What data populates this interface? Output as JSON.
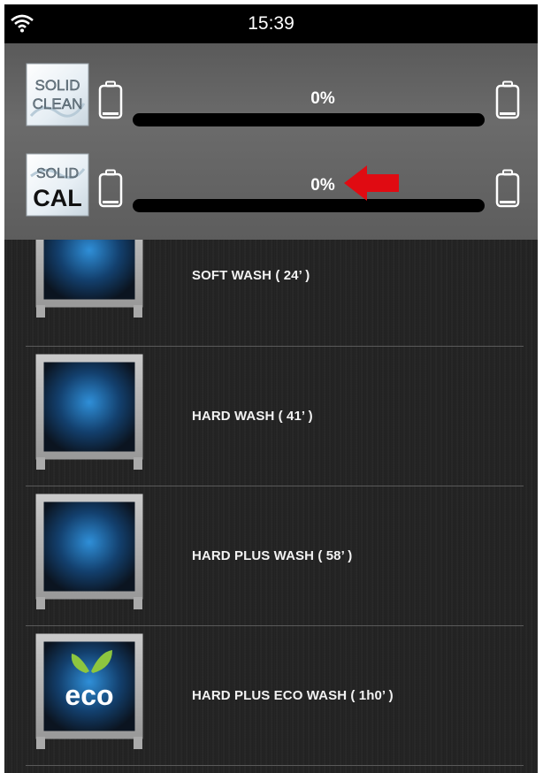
{
  "status_bar": {
    "time": "15:39",
    "wifi_icon": "wifi-icon"
  },
  "products": [
    {
      "logo_text": [
        "SOLID",
        "CLEAN"
      ],
      "left_icon": "battery-empty-icon",
      "right_icon": "battery-empty-icon",
      "level_text": "0%",
      "level_fraction": 0
    },
    {
      "logo_text": [
        "SOLID",
        "CAL"
      ],
      "left_icon": "battery-empty-icon",
      "right_icon": "battery-empty-icon",
      "level_text": "0%",
      "level_fraction": 0
    }
  ],
  "indicator_arrow": {
    "icon": "arrow-left-icon",
    "color": "#e00b12"
  },
  "wash_programs": [
    {
      "label": "SOFT WASH ( 24’ )",
      "icon": "dishwasher-icon"
    },
    {
      "label": "HARD WASH ( 41’ )",
      "icon": "dishwasher-icon"
    },
    {
      "label": "HARD PLUS WASH ( 58’ )",
      "icon": "dishwasher-icon"
    },
    {
      "label": "HARD PLUS ECO WASH ( 1h0’ )",
      "icon": "dishwasher-eco-icon",
      "badge_text": "eco"
    }
  ]
}
